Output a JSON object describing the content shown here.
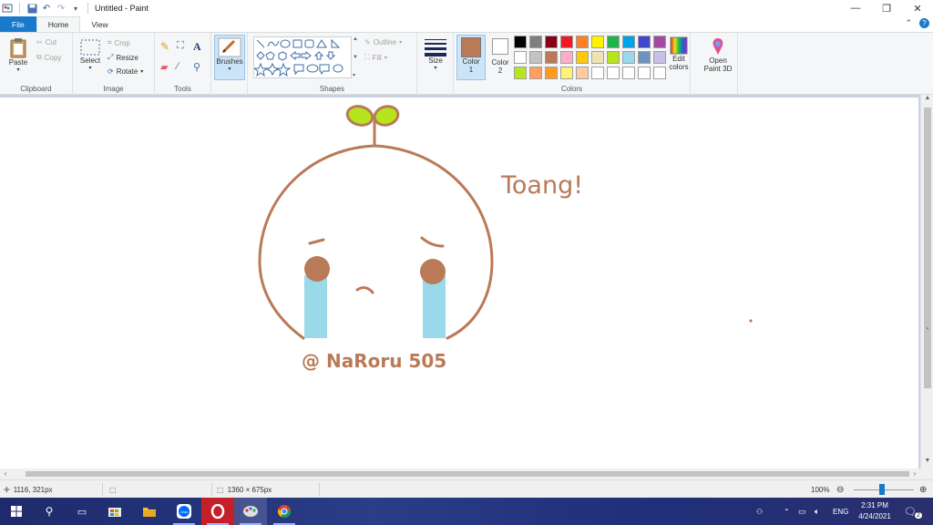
{
  "window": {
    "title": "Untitled - Paint"
  },
  "tabs": {
    "file": "File",
    "home": "Home",
    "view": "View"
  },
  "clipboard": {
    "paste": "Paste",
    "cut": "Cut",
    "copy": "Copy",
    "label": "Clipboard"
  },
  "image": {
    "select": "Select",
    "crop": "Crop",
    "resize": "Resize",
    "rotate": "Rotate",
    "label": "Image"
  },
  "tools": {
    "label": "Tools"
  },
  "brushes": {
    "label": "Brushes"
  },
  "shapes": {
    "outline": "Outline",
    "fill": "Fill",
    "label": "Shapes"
  },
  "size": {
    "label": "Size"
  },
  "colors": {
    "color1_label": "Color",
    "color1_num": "1",
    "color2_label": "Color",
    "color2_num": "2",
    "edit_label": "Edit",
    "edit_label2": "colors",
    "label": "Colors",
    "color1": "#b97a57",
    "color2": "#ffffff",
    "palette_row1": [
      "#000000",
      "#7f7f7f",
      "#880015",
      "#ed1c24",
      "#ff7f27",
      "#fff200",
      "#22b14c",
      "#00a2e8",
      "#3f48cc",
      "#a349a4"
    ],
    "palette_row2": [
      "#ffffff",
      "#c3c3c3",
      "#b97a57",
      "#ffaec9",
      "#ffc90e",
      "#efe4b0",
      "#b5e61d",
      "#99d9ea",
      "#7092be",
      "#c8bfe7"
    ],
    "palette_row3": [
      "#b5e61d",
      "#ff9e5e",
      "#ff9a1e",
      "#fff27a",
      "#ffcba0",
      "#ffffff",
      "#ffffff",
      "#ffffff",
      "#ffffff",
      "#ffffff"
    ]
  },
  "paint3d": {
    "label": "Open",
    "label2": "Paint 3D"
  },
  "drawing": {
    "text_toang": "Toang!",
    "text_signature": "@ NaRoru 505",
    "stroke_color": "#b97a57",
    "leaf_color": "#b5e61d",
    "tear_color": "#99d9ea"
  },
  "status": {
    "cursor": "1116, 321px",
    "canvas_size": "1360 × 675px",
    "zoom": "100%"
  },
  "taskbar": {
    "lang": "ENG",
    "time": "2:31 PM",
    "date": "4/24/2021",
    "notif_count": "2"
  }
}
